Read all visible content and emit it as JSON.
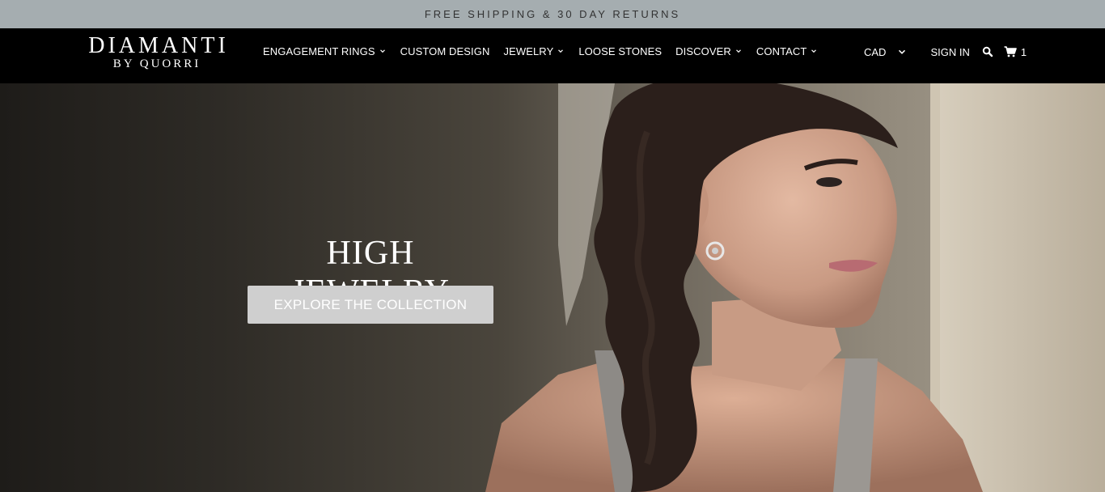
{
  "announcement": "FREE SHIPPING & 30 DAY RETURNS",
  "logo": {
    "line1": "DIAMANTI",
    "line2": "BY QUORRI"
  },
  "nav": {
    "items": [
      {
        "label": "ENGAGEMENT RINGS",
        "dropdown": true
      },
      {
        "label": "CUSTOM DESIGN",
        "dropdown": false
      },
      {
        "label": "JEWELRY",
        "dropdown": true
      },
      {
        "label": "LOOSE STONES",
        "dropdown": false
      },
      {
        "label": "DISCOVER",
        "dropdown": true
      },
      {
        "label": "CONTACT",
        "dropdown": true
      }
    ],
    "currency": "CAD",
    "signin": "SIGN IN",
    "cart_count": "1"
  },
  "hero": {
    "title": "HIGH JEWELRY",
    "button": "EXPLORE THE COLLECTION"
  },
  "colors": {
    "announcement_bg": "#a5adb0",
    "nav_bg": "#000000",
    "button_bg": "#cfcfcf"
  },
  "icons": [
    "chevron-down-icon",
    "search-icon",
    "cart-icon"
  ]
}
